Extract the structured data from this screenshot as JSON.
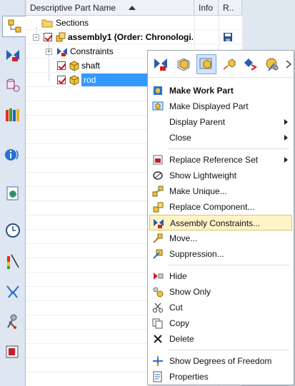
{
  "resource_bar": {
    "icons": [
      "assembly-navigator-icon",
      "constraint-navigator-icon",
      "part-navigator-icon",
      "reuse-library-icon",
      "hd3d-tools-icon",
      "web-browser-icon",
      "history-icon",
      "system-materials-icon",
      "process-studio-icon",
      "manufacturing-wizards-icon",
      "roles-icon"
    ]
  },
  "navigator": {
    "columns": [
      "Descriptive Part Name",
      "Info",
      "R.."
    ],
    "rows": [
      {
        "label": "Sections",
        "level": 1
      },
      {
        "label": "assembly1 (Order: Chronologi...",
        "level": 0
      },
      {
        "label": "Constraints",
        "level": 1
      },
      {
        "label": "shaft",
        "level": 1
      },
      {
        "label": "rod",
        "level": 1,
        "selected": true
      }
    ]
  },
  "context_menu": {
    "toolbar_icons": [
      "replace-component-icon",
      "pack-icon",
      "display-component-icon",
      "move-component-icon",
      "wave-icon",
      "assembly-load-icon",
      "close-icon"
    ],
    "items": [
      {
        "label": "Make Work Part",
        "bold": true,
        "icon": "make-work-part-icon"
      },
      {
        "label": "Make Displayed Part",
        "icon": "make-displayed-part-icon"
      },
      {
        "label": "Display Parent",
        "submenu": true
      },
      {
        "label": "Close",
        "submenu": true
      },
      {
        "label": "Replace Reference Set",
        "submenu": true,
        "icon": "replace-reference-set-icon"
      },
      {
        "label": "Show Lightweight",
        "icon": "lightweight-icon"
      },
      {
        "label": "Make Unique...",
        "icon": "make-unique-icon"
      },
      {
        "label": "Replace Component...",
        "icon": "replace-component-icon"
      },
      {
        "label": "Assembly Constraints...",
        "icon": "assembly-constraints-icon",
        "highlighted": true
      },
      {
        "label": "Move...",
        "icon": "move-icon"
      },
      {
        "label": "Suppression...",
        "icon": "suppression-icon"
      },
      {
        "label": "Hide",
        "icon": "hide-icon"
      },
      {
        "label": "Show Only",
        "icon": "show-only-icon"
      },
      {
        "label": "Cut",
        "icon": "cut-icon"
      },
      {
        "label": "Copy",
        "icon": "copy-icon"
      },
      {
        "label": "Delete",
        "icon": "delete-icon"
      },
      {
        "label": "Show Degrees of Freedom",
        "icon": "degrees-of-freedom-icon"
      },
      {
        "label": "Properties",
        "icon": "properties-icon"
      }
    ]
  }
}
